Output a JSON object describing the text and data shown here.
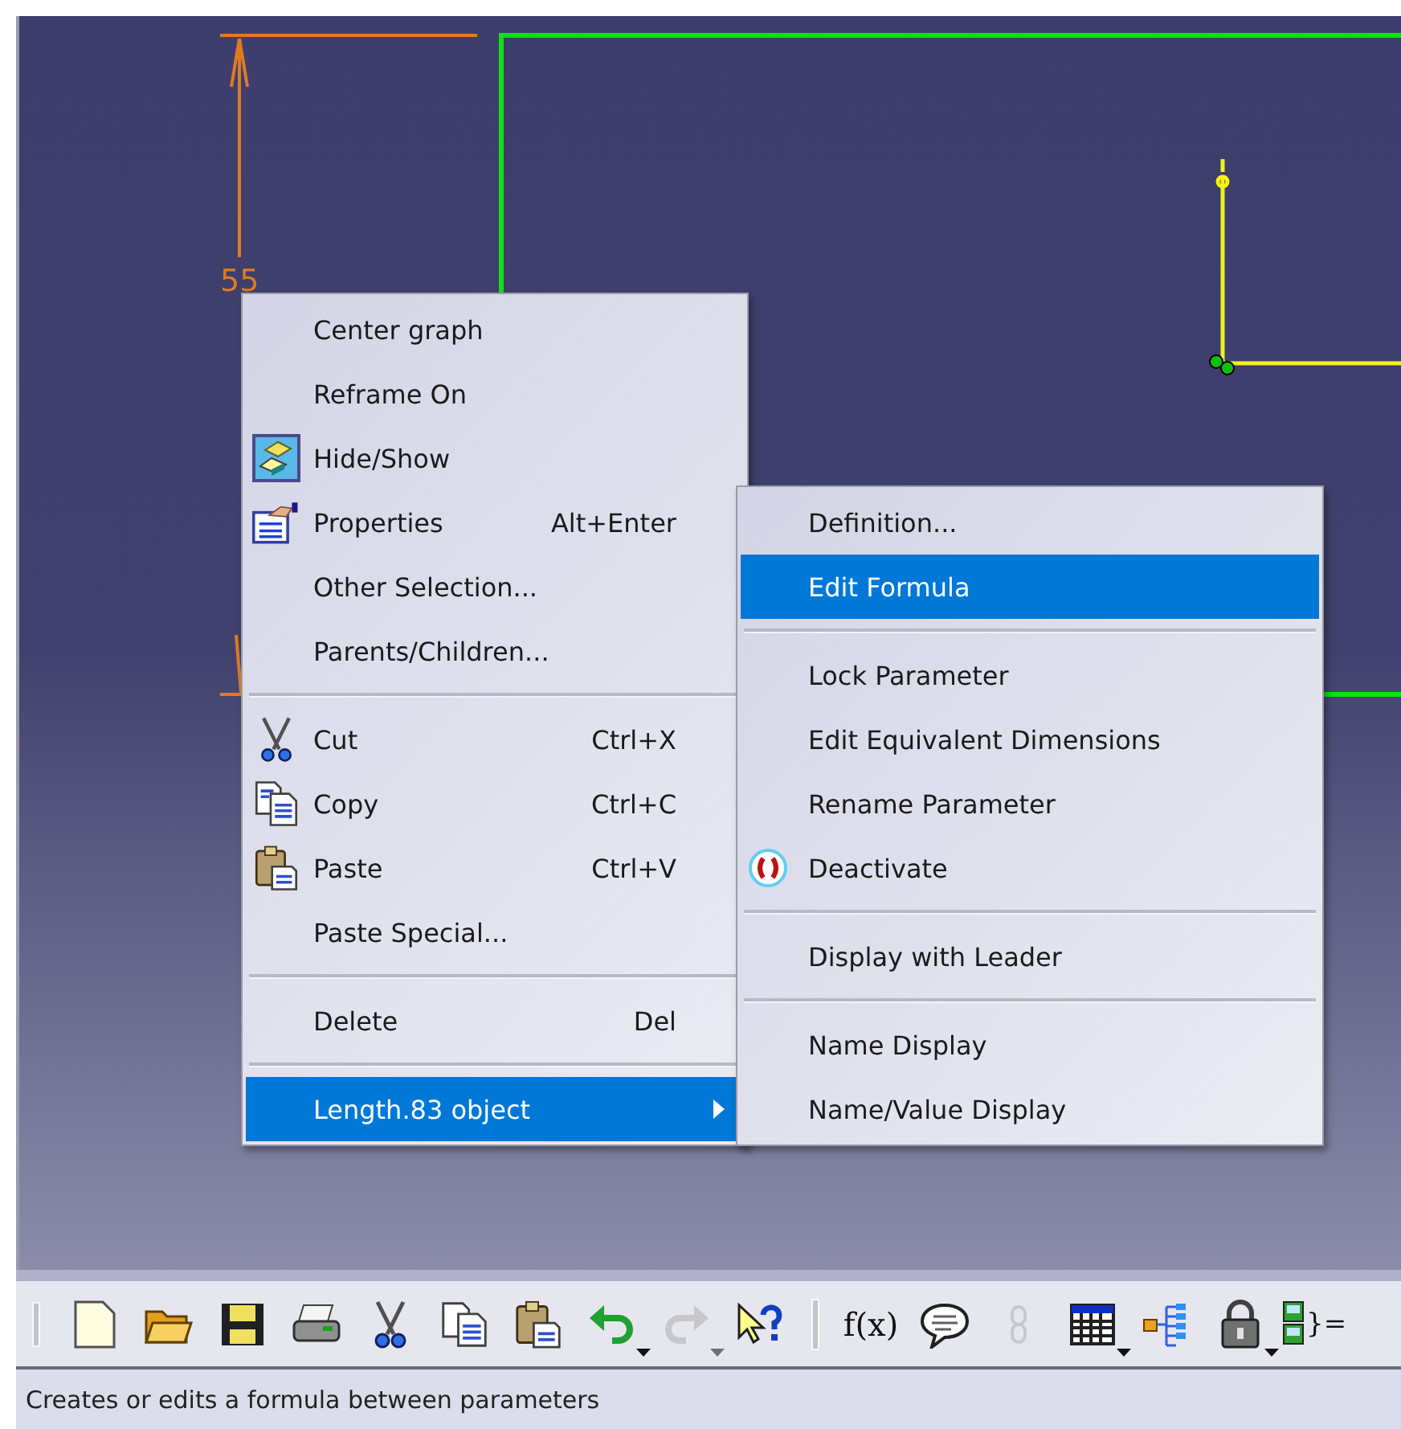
{
  "canvas": {
    "dimension_value": "55"
  },
  "context_menu": {
    "items": [
      {
        "kind": "item",
        "label": "Center graph",
        "selected": false
      },
      {
        "kind": "item",
        "label": "Reframe On",
        "selected": false
      },
      {
        "kind": "item",
        "label": "Hide/Show",
        "selected": false
      },
      {
        "kind": "item",
        "label": "Properties",
        "shortcut": "Alt+Enter",
        "selected": false
      },
      {
        "kind": "item",
        "label": "Other Selection...",
        "selected": false
      },
      {
        "kind": "item",
        "label": "Parents/Children...",
        "selected": false
      },
      {
        "kind": "separator"
      },
      {
        "kind": "item",
        "label": "Cut",
        "shortcut": "Ctrl+X",
        "selected": false
      },
      {
        "kind": "item",
        "label": "Copy",
        "shortcut": "Ctrl+C",
        "selected": false
      },
      {
        "kind": "item",
        "label": "Paste",
        "shortcut": "Ctrl+V",
        "selected": false
      },
      {
        "kind": "item",
        "label": "Paste Special...",
        "selected": false
      },
      {
        "kind": "separator"
      },
      {
        "kind": "item",
        "label": "Delete",
        "shortcut": "Del",
        "selected": false
      },
      {
        "kind": "separator"
      },
      {
        "kind": "submenu",
        "label": "Length.83 object",
        "selected": true
      }
    ]
  },
  "submenu": {
    "items": [
      {
        "kind": "item",
        "label": "Definition...",
        "selected": false
      },
      {
        "kind": "item",
        "label": "Edit Formula",
        "selected": true
      },
      {
        "kind": "separator"
      },
      {
        "kind": "item",
        "label": "Lock Parameter",
        "selected": false
      },
      {
        "kind": "item",
        "label": "Edit Equivalent Dimensions",
        "selected": false
      },
      {
        "kind": "item",
        "label": "Rename Parameter",
        "selected": false
      },
      {
        "kind": "item",
        "label": "Deactivate",
        "selected": false
      },
      {
        "kind": "separator"
      },
      {
        "kind": "item",
        "label": "Display with Leader",
        "selected": false
      },
      {
        "kind": "separator"
      },
      {
        "kind": "item",
        "label": "Name Display",
        "selected": false
      },
      {
        "kind": "item",
        "label": "Name/Value Display",
        "selected": false
      }
    ]
  },
  "toolbar": {
    "groups": [
      {
        "buttons": [
          {
            "dropdown": false,
            "disabled": false
          },
          {
            "dropdown": false,
            "disabled": false
          },
          {
            "dropdown": false,
            "disabled": false
          },
          {
            "dropdown": false,
            "disabled": false
          },
          {
            "dropdown": false,
            "disabled": false
          },
          {
            "dropdown": false,
            "disabled": false
          },
          {
            "dropdown": false,
            "disabled": false
          },
          {
            "dropdown": true,
            "disabled": false
          },
          {
            "dropdown": true,
            "disabled": true
          },
          {
            "dropdown": false,
            "disabled": false
          }
        ]
      },
      {
        "buttons": [
          {
            "label": "f(x)",
            "dropdown": false,
            "disabled": false
          },
          {
            "dropdown": false,
            "disabled": false
          },
          {
            "dropdown": false,
            "disabled": true
          },
          {
            "dropdown": true,
            "disabled": false
          },
          {
            "dropdown": false,
            "disabled": false
          },
          {
            "dropdown": true,
            "disabled": false
          },
          {
            "label": "}=",
            "dropdown": false,
            "disabled": false
          }
        ]
      }
    ]
  },
  "status_bar": {
    "text": "Creates or edits a formula between parameters"
  }
}
